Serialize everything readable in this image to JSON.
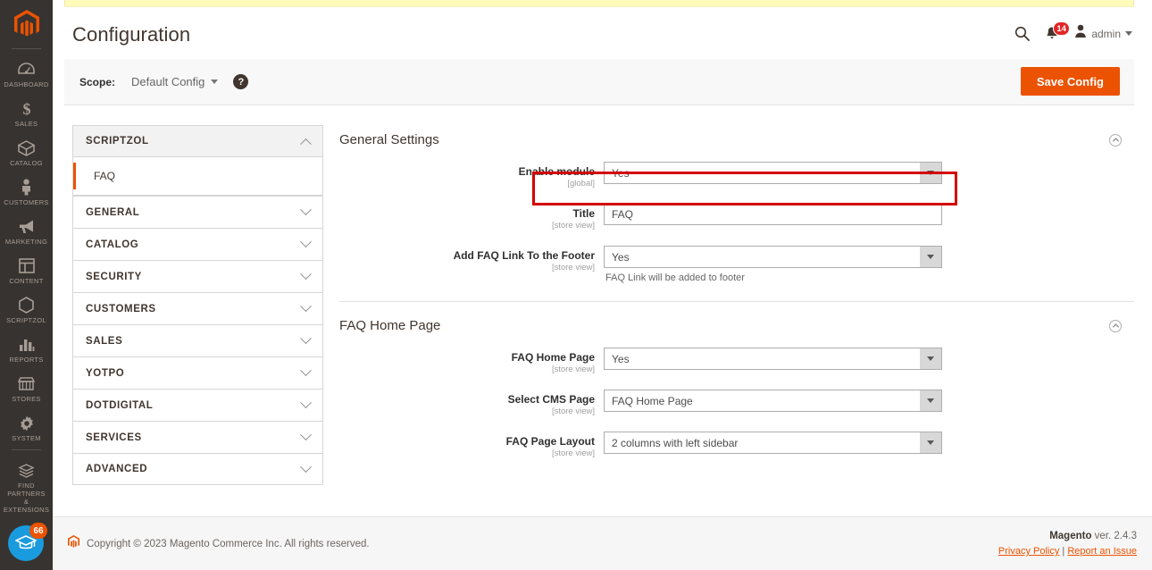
{
  "rail": {
    "logo_icon": "magento-logo-icon",
    "items": [
      {
        "label": "DASHBOARD",
        "icon": "dashboard-icon"
      },
      {
        "label": "SALES",
        "icon": "dollar-icon"
      },
      {
        "label": "CATALOG",
        "icon": "box-icon"
      },
      {
        "label": "CUSTOMERS",
        "icon": "person-icon"
      },
      {
        "label": "MARKETING",
        "icon": "megaphone-icon"
      },
      {
        "label": "CONTENT",
        "icon": "layout-icon"
      },
      {
        "label": "SCRIPTZOL",
        "icon": "hexagon-icon"
      },
      {
        "label": "REPORTS",
        "icon": "bar-chart-icon"
      },
      {
        "label": "STORES",
        "icon": "store-icon"
      },
      {
        "label": "SYSTEM",
        "icon": "gear-icon"
      }
    ],
    "partners": {
      "line1": "FIND PARTNERS",
      "line2": "& EXTENSIONS",
      "icon": "blocks-icon"
    },
    "education": {
      "badge": "66",
      "icon": "graduation-cap-icon"
    }
  },
  "header": {
    "title": "Configuration",
    "search_icon": "search-icon",
    "notifications_icon": "bell-icon",
    "notifications_count": "14",
    "user_icon": "user-icon",
    "user_name": "admin"
  },
  "scope_bar": {
    "label": "Scope:",
    "value": "Default Config",
    "help_icon": "question-mark-icon",
    "save_label": "Save Config"
  },
  "config_nav": {
    "sections": [
      {
        "label": "SCRIPTZOL",
        "expanded": true,
        "children": [
          {
            "label": "FAQ",
            "current": true
          }
        ]
      },
      {
        "label": "GENERAL",
        "expanded": false
      },
      {
        "label": "CATALOG",
        "expanded": false
      },
      {
        "label": "SECURITY",
        "expanded": false
      },
      {
        "label": "CUSTOMERS",
        "expanded": false
      },
      {
        "label": "SALES",
        "expanded": false
      },
      {
        "label": "YOTPO",
        "expanded": false
      },
      {
        "label": "DOTDIGITAL",
        "expanded": false
      },
      {
        "label": "SERVICES",
        "expanded": false
      },
      {
        "label": "ADVANCED",
        "expanded": false
      }
    ]
  },
  "form": {
    "general_settings": {
      "title": "General Settings",
      "collapse_icon": "chevron-up-circle-icon",
      "fields": [
        {
          "label": "Enable module",
          "scope": "[global]",
          "type": "select",
          "value": "Yes",
          "note": ""
        },
        {
          "label": "Title",
          "scope": "[store view]",
          "type": "text",
          "value": "FAQ",
          "note": "",
          "highlighted": true
        },
        {
          "label": "Add FAQ Link To the Footer",
          "scope": "[store view]",
          "type": "select",
          "value": "Yes",
          "note": "FAQ Link will be added to footer"
        }
      ]
    },
    "faq_home_page": {
      "title": "FAQ Home Page",
      "collapse_icon": "chevron-up-circle-icon",
      "fields": [
        {
          "label": "FAQ Home Page",
          "scope": "[store view]",
          "type": "select",
          "value": "Yes",
          "note": ""
        },
        {
          "label": "Select CMS Page",
          "scope": "[store view]",
          "type": "select",
          "value": "FAQ Home Page",
          "note": ""
        },
        {
          "label": "FAQ Page Layout",
          "scope": "[store view]",
          "type": "select",
          "value": "2 columns with left sidebar",
          "note": ""
        }
      ]
    }
  },
  "footer": {
    "copyright": "Copyright © 2023 Magento Commerce Inc. All rights reserved.",
    "logo_icon": "magento-logo-icon",
    "brand": "Magento",
    "version": " ver. 2.4.3",
    "privacy_link": "Privacy Policy",
    "separator": "|",
    "issue_link": "Report an Issue"
  },
  "colors": {
    "accent": "#eb5202",
    "rail_bg": "#373330",
    "annotation": "#d40000",
    "notification": "#e22626",
    "edu_blue": "#1a9bde"
  }
}
